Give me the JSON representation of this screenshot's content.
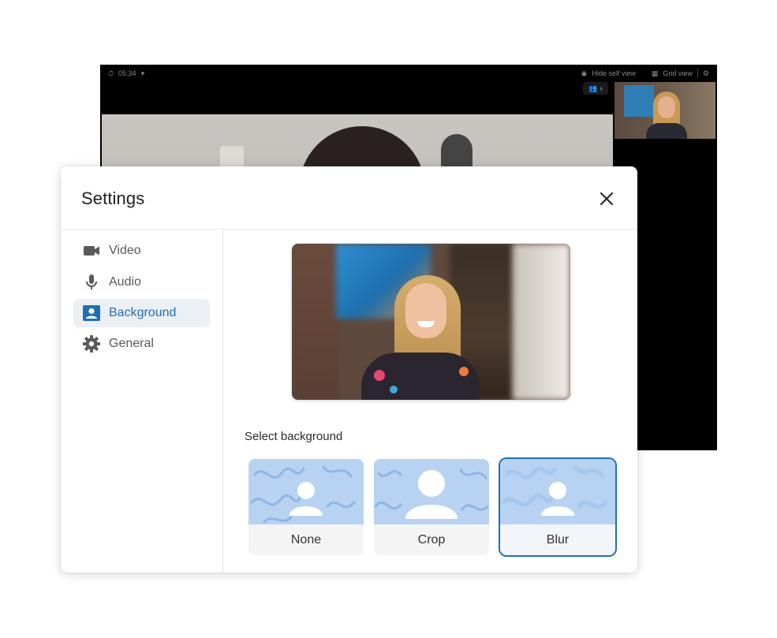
{
  "call_window": {
    "timer": "05:34",
    "toolbar_items": [
      "Hide self view",
      "Grid view"
    ]
  },
  "dialog": {
    "title": "Settings"
  },
  "sidebar": {
    "items": [
      {
        "label": "Video",
        "icon": "video-camera-icon",
        "active": false
      },
      {
        "label": "Audio",
        "icon": "microphone-icon",
        "active": false
      },
      {
        "label": "Background",
        "icon": "person-card-icon",
        "active": true
      },
      {
        "label": "General",
        "icon": "gear-icon",
        "active": false
      }
    ]
  },
  "content": {
    "section_label": "Select background",
    "options": [
      {
        "label": "None",
        "selected": false
      },
      {
        "label": "Crop",
        "selected": false
      },
      {
        "label": "Blur",
        "selected": true
      }
    ]
  },
  "colors": {
    "accent": "#1f6fb3",
    "thumb_bg": "#b7d3f1",
    "nav_active_bg": "#eceff4"
  }
}
